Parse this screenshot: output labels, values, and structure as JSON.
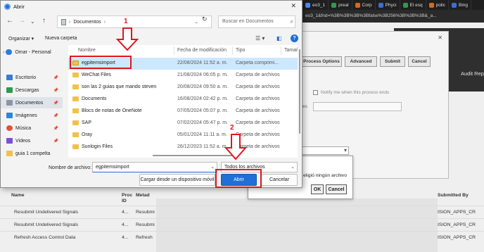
{
  "browser": {
    "tabs": [
      "eo3_1",
      "preal",
      "Corp",
      "Phyci",
      "El esq",
      "polic",
      "Bing"
    ],
    "url": "eo3_1&fnd=%3B%3B%3B%3Bfalse%3B256%3B%3B%3B&_a..."
  },
  "background": {
    "buttons": [
      "Process Options",
      "Advanced",
      "Submit",
      "Cancel"
    ],
    "notify_label": "Notify me when this process ends",
    "field_label": "es",
    "audit_label": "Audit Rep",
    "table": {
      "headers": [
        "Name",
        "Proc ID",
        "Metad",
        "Submitted By"
      ],
      "rows": [
        {
          "name": "Resubmit Undelivered Signals",
          "id": "4...",
          "meta": "Resubmi",
          "by": "ISION_APPS_CR"
        },
        {
          "name": "Resubmit Undelivered Signals",
          "id": "4...",
          "meta": "Resubmi",
          "by": "ISION_APPS_CR"
        },
        {
          "name": "Refresh Access Control Data",
          "id": "4...",
          "meta": "Refresh",
          "by": "ISION_APPS_CR"
        }
      ]
    }
  },
  "msgbox": {
    "text": "eligió ningún archivo",
    "ok": "OK",
    "cancel": "Cancel"
  },
  "dialog": {
    "title": "Abrir",
    "close": "✕",
    "breadcrumb": "Documentos",
    "search_placeholder": "Buscar en Documentos",
    "organize": "Organizar ▾",
    "new_folder": "Nueva carpeta",
    "nav_items": [
      {
        "label": "Omar - Personal"
      },
      {
        "label": "Escritorio"
      },
      {
        "label": "Descargas"
      },
      {
        "label": "Documentos"
      },
      {
        "label": "Imágenes"
      },
      {
        "label": "Música"
      },
      {
        "label": "Videos"
      },
      {
        "label": "guia 1 compelta"
      }
    ],
    "columns": [
      "Nombre",
      "Fecha de modificación",
      "Tipo",
      "Tamaño"
    ],
    "files": [
      {
        "name": "egpitemsimport",
        "date": "22/08/2024 11:52 a. m.",
        "type": "Carpeta comprimi..."
      },
      {
        "name": "WeChat Files",
        "date": "21/08/2024 06:05 p. m.",
        "type": "Carpeta de archivos"
      },
      {
        "name": "son las 2 guias que mando steven",
        "date": "20/08/2024 09:50 a. m.",
        "type": "Carpeta de archivos"
      },
      {
        "name": "Documents",
        "date": "16/08/2024 02:42 p. m.",
        "type": "Carpeta de archivos"
      },
      {
        "name": "Blocs de notas de OneNote",
        "date": "07/05/2024 05:07 p. m.",
        "type": "Carpeta de archivos"
      },
      {
        "name": "SAP",
        "date": "07/02/2024 05:47 p. m.",
        "type": "Carpeta de archivos"
      },
      {
        "name": "Oray",
        "date": "05/01/2024 11:11 a. m.",
        "type": "Carpeta de archivos"
      },
      {
        "name": "Sunlogin Files",
        "date": "26/12/2023 11:52 a. m.",
        "type": "Carpeta de archivos"
      }
    ],
    "filename_label": "Nombre de archivo:",
    "filename_value": "egpitemsimport",
    "filetype_value": "Todos los archivos",
    "load_device": "Cargar desde un dispositivo móvil",
    "open": "Abrir",
    "cancel": "Cancelar"
  },
  "annotations": {
    "step1": "1",
    "step2": "2"
  },
  "colors": {
    "accent": "#1f6fd6",
    "annotation": "#e0161e",
    "selection": "#cce8ff"
  }
}
